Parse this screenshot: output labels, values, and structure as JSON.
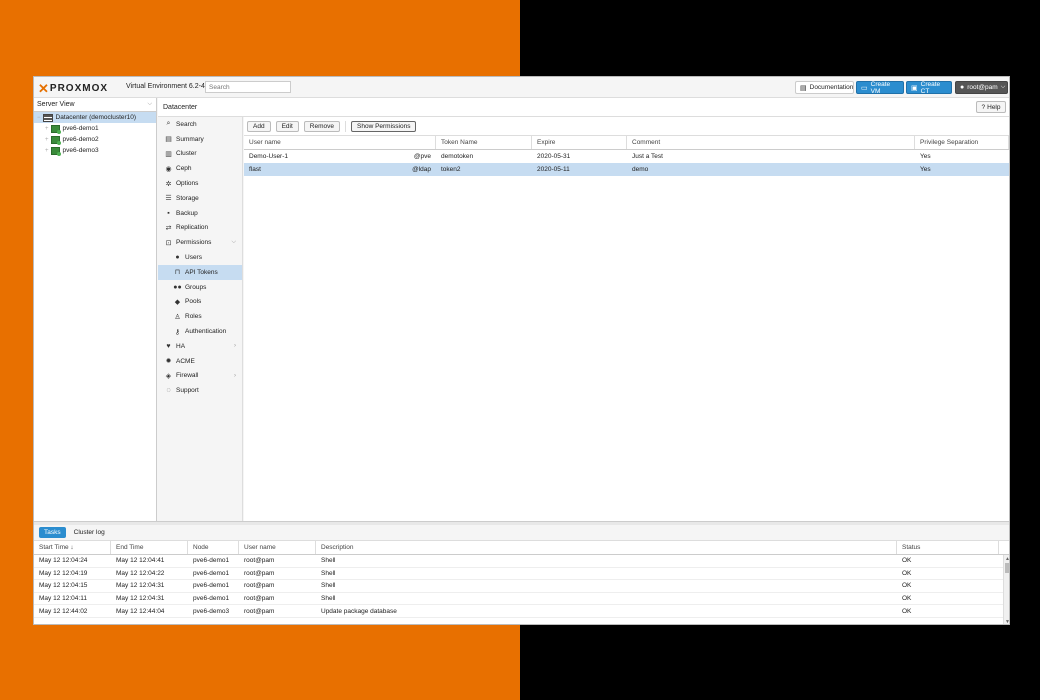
{
  "header": {
    "brand": "PROXMOX",
    "version": "Virtual Environment 6.2-4",
    "search_placeholder": "Search",
    "documentation": "Documentation",
    "create_vm": "Create VM",
    "create_ct": "Create CT",
    "user": "root@pam"
  },
  "tree": {
    "view": "Server View",
    "datacenter": "Datacenter (democluster10)",
    "nodes": [
      "pve6-demo1",
      "pve6-demo2",
      "pve6-demo3"
    ]
  },
  "content": {
    "title": "Datacenter",
    "help": "Help"
  },
  "menu": {
    "items": [
      {
        "label": "Search",
        "icon": "search-icon"
      },
      {
        "label": "Summary",
        "icon": "book-icon"
      },
      {
        "label": "Cluster",
        "icon": "server-icon"
      },
      {
        "label": "Ceph",
        "icon": "ceph-icon"
      },
      {
        "label": "Options",
        "icon": "gear-icon"
      },
      {
        "label": "Storage",
        "icon": "database-icon"
      },
      {
        "label": "Backup",
        "icon": "floppy-icon"
      },
      {
        "label": "Replication",
        "icon": "retweet-icon"
      },
      {
        "label": "Permissions",
        "icon": "unlock-icon"
      },
      {
        "label": "Users",
        "icon": "user-icon"
      },
      {
        "label": "API Tokens",
        "icon": "lock-icon"
      },
      {
        "label": "Groups",
        "icon": "users-icon"
      },
      {
        "label": "Pools",
        "icon": "tags-icon"
      },
      {
        "label": "Roles",
        "icon": "male-icon"
      },
      {
        "label": "Authentication",
        "icon": "key-icon"
      },
      {
        "label": "HA",
        "icon": "heartbeat-icon"
      },
      {
        "label": "ACME",
        "icon": "certificate-icon"
      },
      {
        "label": "Firewall",
        "icon": "shield-icon"
      },
      {
        "label": "Support",
        "icon": "comments-icon"
      }
    ]
  },
  "toolbar": {
    "add": "Add",
    "edit": "Edit",
    "remove": "Remove",
    "show_permissions": "Show Permissions"
  },
  "tokens": {
    "columns": [
      "User name",
      "Token Name",
      "Expire",
      "Comment",
      "Privilege Separation"
    ],
    "rows": [
      {
        "user": "Demo-User-1",
        "realm": "@pve",
        "token": "demotoken",
        "expire": "2020-05-31",
        "comment": "Just a Test",
        "priv": "Yes"
      },
      {
        "user": "flast",
        "realm": "@ldap",
        "token": "token2",
        "expire": "2020-05-11",
        "comment": "demo",
        "priv": "Yes"
      }
    ]
  },
  "tasks": {
    "tabs": [
      "Tasks",
      "Cluster log"
    ],
    "columns": [
      "Start Time ↓",
      "End Time",
      "Node",
      "User name",
      "Description",
      "Status"
    ],
    "rows": [
      {
        "start": "May 12 12:04:24",
        "end": "May 12 12:04:41",
        "node": "pve6-demo1",
        "user": "root@pam",
        "desc": "Shell",
        "status": "OK"
      },
      {
        "start": "May 12 12:04:19",
        "end": "May 12 12:04:22",
        "node": "pve6-demo1",
        "user": "root@pam",
        "desc": "Shell",
        "status": "OK"
      },
      {
        "start": "May 12 12:04:15",
        "end": "May 12 12:04:31",
        "node": "pve6-demo1",
        "user": "root@pam",
        "desc": "Shell",
        "status": "OK"
      },
      {
        "start": "May 12 12:04:11",
        "end": "May 12 12:04:31",
        "node": "pve6-demo1",
        "user": "root@pam",
        "desc": "Shell",
        "status": "OK"
      },
      {
        "start": "May 12 12:44:02",
        "end": "May 12 12:44:04",
        "node": "pve6-demo3",
        "user": "root@pam",
        "desc": "Update package database",
        "status": "OK"
      }
    ]
  },
  "colors": {
    "accent": "#2b8dcf",
    "brand_orange": "#e57000",
    "selection": "#c6dcf1"
  }
}
